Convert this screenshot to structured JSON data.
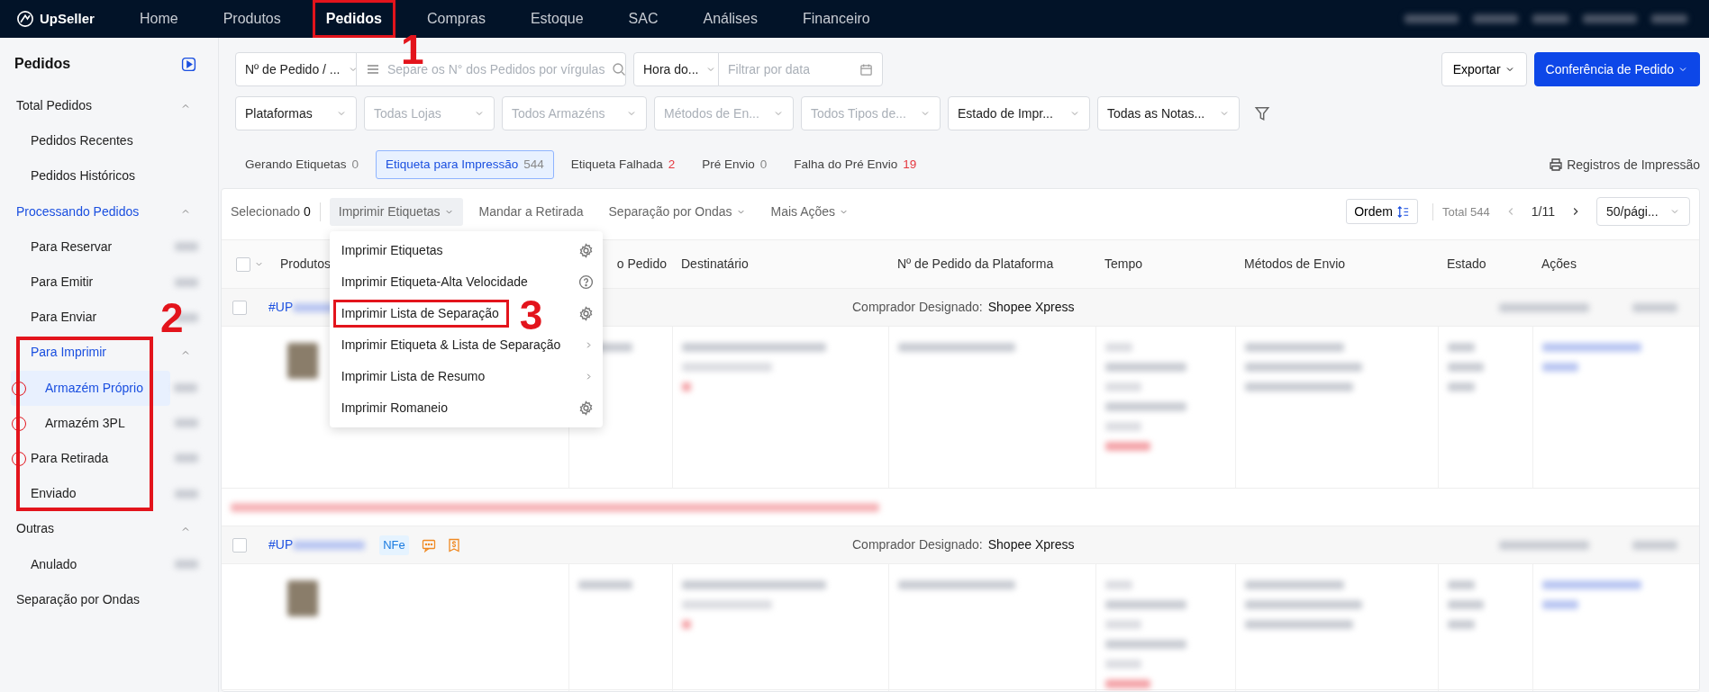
{
  "nav": {
    "brand": "UpSeller",
    "items": [
      {
        "label": "Home",
        "selected": false,
        "boxed": false
      },
      {
        "label": "Produtos",
        "selected": false,
        "boxed": false
      },
      {
        "label": "Pedidos",
        "selected": true,
        "boxed": true
      },
      {
        "label": "Compras",
        "selected": false,
        "boxed": false
      },
      {
        "label": "Estoque",
        "selected": false,
        "boxed": false
      },
      {
        "label": "SAC",
        "selected": false,
        "boxed": false
      },
      {
        "label": "Análises",
        "selected": false,
        "boxed": false
      },
      {
        "label": "Financeiro",
        "selected": false,
        "boxed": false
      }
    ]
  },
  "sidebar": {
    "title": "Pedidos",
    "items": [
      {
        "label": "Total Pedidos",
        "expanded": true,
        "children": [
          {
            "label": "Pedidos Recentes",
            "selected": false
          },
          {
            "label": "Pedidos Históricos",
            "selected": false
          }
        ]
      },
      {
        "label": "Processando Pedidos",
        "expanded": true,
        "children": [
          {
            "label": "Para Reservar",
            "selected": false,
            "count": true
          },
          {
            "label": "Para Emitir",
            "selected": false,
            "count": true
          },
          {
            "label": "Para Enviar",
            "selected": false,
            "count": true
          },
          {
            "label": "Para Imprimir",
            "expanded": true,
            "boxed": true,
            "children": [
              {
                "label": "Armazém Próprio",
                "selected": true,
                "count": true,
                "circled": true
              },
              {
                "label": "Armazém 3PL",
                "selected": false,
                "count": true,
                "circled": true
              }
            ]
          },
          {
            "label": "Para Retirada",
            "selected": false,
            "count": true,
            "circled": true,
            "boxed": true
          },
          {
            "label": "Enviado",
            "selected": false,
            "count": true,
            "boxed": true
          }
        ]
      },
      {
        "label": "Outras",
        "expanded": true,
        "children": [
          {
            "label": "Anulado",
            "selected": false,
            "count": true
          }
        ]
      },
      {
        "label": "Separação por Ondas"
      }
    ]
  },
  "filters": {
    "row_1": [
      {
        "kind": "select",
        "value": "Nº de Pedido / ..."
      },
      {
        "kind": "search",
        "placeholder": "Separe os N° dos Pedidos por vírgulas"
      },
      {
        "kind": "select",
        "value": "Hora do..."
      },
      {
        "kind": "date",
        "placeholder": "Filtrar por data"
      }
    ],
    "row_2": [
      {
        "kind": "select",
        "value": "Plataformas"
      },
      {
        "kind": "select",
        "placeholder": "Todas Lojas"
      },
      {
        "kind": "select",
        "placeholder": "Todos Armazéns"
      },
      {
        "kind": "select",
        "placeholder": "Métodos de En..."
      },
      {
        "kind": "select",
        "placeholder": "Todos Tipos de..."
      },
      {
        "kind": "select",
        "value": "Estado de Impr..."
      },
      {
        "kind": "select",
        "value": "Todas as Notas..."
      }
    ],
    "buttons": [
      {
        "label": "Exportar",
        "primary": false
      },
      {
        "label": "Conferência de Pedido",
        "primary": true
      }
    ]
  },
  "tabs": [
    {
      "label": "Gerando Etiquetas",
      "count": "0",
      "alert": false,
      "selected": false
    },
    {
      "label": "Etiqueta para Impressão",
      "count": "544",
      "alert": false,
      "selected": true
    },
    {
      "label": "Etiqueta Falhada",
      "count": "2",
      "alert": true,
      "selected": false
    },
    {
      "label": "Pré Envio",
      "count": "0",
      "alert": false,
      "selected": false
    },
    {
      "label": "Falha do Pré Envio",
      "count": "19",
      "alert": true,
      "selected": false
    }
  ],
  "print_records": "Registros de Impressão",
  "toolbar": {
    "selected_label": "Selecionado",
    "selected_count": "0",
    "actions": [
      {
        "label": "Imprimir Etiquetas",
        "dropdown": true,
        "selected": true
      },
      {
        "label": "Mandar a Retirada",
        "dropdown": false,
        "selected": false
      },
      {
        "label": "Separação por Ondas",
        "dropdown": true,
        "selected": false
      },
      {
        "label": "Mais Ações",
        "dropdown": true,
        "selected": false
      }
    ],
    "sort": "Ordem",
    "total": "Total 544",
    "page": "1/11",
    "page_size": "50/pági..."
  },
  "menu": [
    {
      "label": "Imprimir Etiquetas",
      "kind": "settings",
      "boxed": false
    },
    {
      "label": "Imprimir Etiqueta-Alta Velocidade",
      "kind": "help",
      "boxed": false
    },
    {
      "label": "Imprimir Lista de Separação",
      "kind": "settings",
      "boxed": true
    },
    {
      "label": "Imprimir Etiqueta & Lista de Separação",
      "kind": "submenu",
      "boxed": false
    },
    {
      "label": "Imprimir Lista de Resumo",
      "kind": "submenu",
      "boxed": false
    },
    {
      "label": "Imprimir Romaneio",
      "kind": "settings",
      "boxed": false
    }
  ],
  "table": {
    "select_all": {
      "checked": false
    },
    "columns": [
      "Produtos",
      "o Pedido",
      "Destinatário",
      "Nº de Pedido da Plataforma",
      "Tempo",
      "Métodos de Envio",
      "Estado",
      "Ações"
    ],
    "orders": [
      {
        "checked": false,
        "number": "#UP",
        "carrier_label": "Comprador Designado:",
        "carrier": "Shopee Xpress",
        "warning": true
      },
      {
        "checked": false,
        "number": "#UP",
        "tags": [
          {
            "kind": "badge",
            "label": "NFe"
          },
          {
            "kind": "chat"
          },
          {
            "kind": "receipt"
          }
        ],
        "carrier_label": "Comprador Designado:",
        "carrier": "Shopee Xpress",
        "warning": false
      }
    ]
  },
  "annotations": [
    {
      "label": "1"
    },
    {
      "label": "2"
    },
    {
      "label": "3"
    }
  ]
}
